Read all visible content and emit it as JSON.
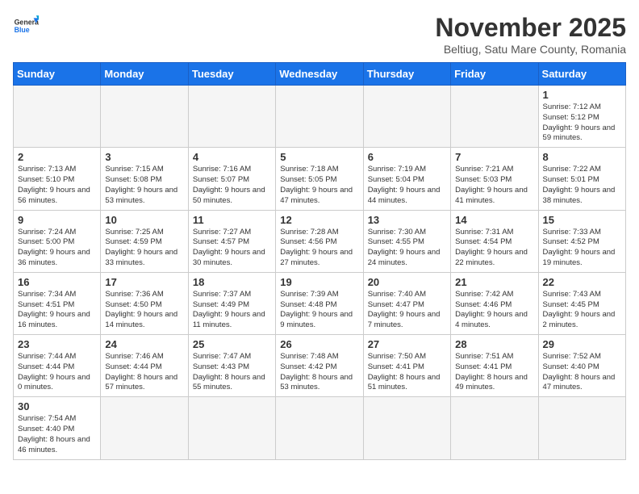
{
  "header": {
    "logo": {
      "line1": "General",
      "line2": "Blue"
    },
    "title": "November 2025",
    "subtitle": "Beltiug, Satu Mare County, Romania"
  },
  "weekdays": [
    "Sunday",
    "Monday",
    "Tuesday",
    "Wednesday",
    "Thursday",
    "Friday",
    "Saturday"
  ],
  "weeks": [
    [
      {
        "day": "",
        "info": ""
      },
      {
        "day": "",
        "info": ""
      },
      {
        "day": "",
        "info": ""
      },
      {
        "day": "",
        "info": ""
      },
      {
        "day": "",
        "info": ""
      },
      {
        "day": "",
        "info": ""
      },
      {
        "day": "1",
        "info": "Sunrise: 7:12 AM\nSunset: 5:12 PM\nDaylight: 9 hours\nand 59 minutes."
      }
    ],
    [
      {
        "day": "2",
        "info": "Sunrise: 7:13 AM\nSunset: 5:10 PM\nDaylight: 9 hours\nand 56 minutes."
      },
      {
        "day": "3",
        "info": "Sunrise: 7:15 AM\nSunset: 5:08 PM\nDaylight: 9 hours\nand 53 minutes."
      },
      {
        "day": "4",
        "info": "Sunrise: 7:16 AM\nSunset: 5:07 PM\nDaylight: 9 hours\nand 50 minutes."
      },
      {
        "day": "5",
        "info": "Sunrise: 7:18 AM\nSunset: 5:05 PM\nDaylight: 9 hours\nand 47 minutes."
      },
      {
        "day": "6",
        "info": "Sunrise: 7:19 AM\nSunset: 5:04 PM\nDaylight: 9 hours\nand 44 minutes."
      },
      {
        "day": "7",
        "info": "Sunrise: 7:21 AM\nSunset: 5:03 PM\nDaylight: 9 hours\nand 41 minutes."
      },
      {
        "day": "8",
        "info": "Sunrise: 7:22 AM\nSunset: 5:01 PM\nDaylight: 9 hours\nand 38 minutes."
      }
    ],
    [
      {
        "day": "9",
        "info": "Sunrise: 7:24 AM\nSunset: 5:00 PM\nDaylight: 9 hours\nand 36 minutes."
      },
      {
        "day": "10",
        "info": "Sunrise: 7:25 AM\nSunset: 4:59 PM\nDaylight: 9 hours\nand 33 minutes."
      },
      {
        "day": "11",
        "info": "Sunrise: 7:27 AM\nSunset: 4:57 PM\nDaylight: 9 hours\nand 30 minutes."
      },
      {
        "day": "12",
        "info": "Sunrise: 7:28 AM\nSunset: 4:56 PM\nDaylight: 9 hours\nand 27 minutes."
      },
      {
        "day": "13",
        "info": "Sunrise: 7:30 AM\nSunset: 4:55 PM\nDaylight: 9 hours\nand 24 minutes."
      },
      {
        "day": "14",
        "info": "Sunrise: 7:31 AM\nSunset: 4:54 PM\nDaylight: 9 hours\nand 22 minutes."
      },
      {
        "day": "15",
        "info": "Sunrise: 7:33 AM\nSunset: 4:52 PM\nDaylight: 9 hours\nand 19 minutes."
      }
    ],
    [
      {
        "day": "16",
        "info": "Sunrise: 7:34 AM\nSunset: 4:51 PM\nDaylight: 9 hours\nand 16 minutes."
      },
      {
        "day": "17",
        "info": "Sunrise: 7:36 AM\nSunset: 4:50 PM\nDaylight: 9 hours\nand 14 minutes."
      },
      {
        "day": "18",
        "info": "Sunrise: 7:37 AM\nSunset: 4:49 PM\nDaylight: 9 hours\nand 11 minutes."
      },
      {
        "day": "19",
        "info": "Sunrise: 7:39 AM\nSunset: 4:48 PM\nDaylight: 9 hours\nand 9 minutes."
      },
      {
        "day": "20",
        "info": "Sunrise: 7:40 AM\nSunset: 4:47 PM\nDaylight: 9 hours\nand 7 minutes."
      },
      {
        "day": "21",
        "info": "Sunrise: 7:42 AM\nSunset: 4:46 PM\nDaylight: 9 hours\nand 4 minutes."
      },
      {
        "day": "22",
        "info": "Sunrise: 7:43 AM\nSunset: 4:45 PM\nDaylight: 9 hours\nand 2 minutes."
      }
    ],
    [
      {
        "day": "23",
        "info": "Sunrise: 7:44 AM\nSunset: 4:44 PM\nDaylight: 9 hours\nand 0 minutes."
      },
      {
        "day": "24",
        "info": "Sunrise: 7:46 AM\nSunset: 4:44 PM\nDaylight: 8 hours\nand 57 minutes."
      },
      {
        "day": "25",
        "info": "Sunrise: 7:47 AM\nSunset: 4:43 PM\nDaylight: 8 hours\nand 55 minutes."
      },
      {
        "day": "26",
        "info": "Sunrise: 7:48 AM\nSunset: 4:42 PM\nDaylight: 8 hours\nand 53 minutes."
      },
      {
        "day": "27",
        "info": "Sunrise: 7:50 AM\nSunset: 4:41 PM\nDaylight: 8 hours\nand 51 minutes."
      },
      {
        "day": "28",
        "info": "Sunrise: 7:51 AM\nSunset: 4:41 PM\nDaylight: 8 hours\nand 49 minutes."
      },
      {
        "day": "29",
        "info": "Sunrise: 7:52 AM\nSunset: 4:40 PM\nDaylight: 8 hours\nand 47 minutes."
      }
    ],
    [
      {
        "day": "30",
        "info": "Sunrise: 7:54 AM\nSunset: 4:40 PM\nDaylight: 8 hours\nand 46 minutes."
      },
      {
        "day": "",
        "info": ""
      },
      {
        "day": "",
        "info": ""
      },
      {
        "day": "",
        "info": ""
      },
      {
        "day": "",
        "info": ""
      },
      {
        "day": "",
        "info": ""
      },
      {
        "day": "",
        "info": ""
      }
    ]
  ]
}
